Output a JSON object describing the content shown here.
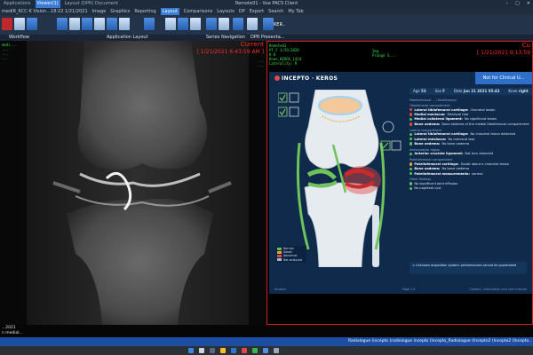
{
  "window": {
    "tabs": [
      "Applications",
      "Viewer(1)",
      "Layout (DPR) Document"
    ],
    "active_tab_index": 1,
    "title": "Remote01 - Vue PACS Client",
    "controls": [
      "–",
      "□",
      "✕"
    ]
  },
  "menu": {
    "items": [
      "mediR_6CC-K Vision...18:22 1/21/2021",
      "Image",
      "Graphics",
      "Reporting",
      "Layout",
      "Comparisons",
      "Layouts",
      "DP",
      "Export",
      "Search",
      "My Tab"
    ],
    "active_index": 4
  },
  "sections": {
    "workflow": "Workflow",
    "app_layout": "Application Layout",
    "series_nav": "Series Navigation",
    "dpr": "DPR Presenta...",
    "kero_btn": "KER.."
  },
  "left_viewport": {
    "current_label": "Current",
    "current_date": "[ 1/21/2021 6:43:59 AM ]",
    "overlay_left": [
      "medi...",
      "...",
      "...",
      "..."
    ],
    "overlay_right": [
      "...",
      "..."
    ]
  },
  "right_viewport": {
    "current_label": "Cu",
    "current_date": "[ 1/21/2021 9:13:59",
    "overlay": [
      "Remote01",
      "PT F 1/29/2020",
      "K-8",
      "Knee_KEROS_1424",
      "Laterality: R"
    ],
    "overlay_right": [
      "Img",
      "Prange S..."
    ]
  },
  "report": {
    "brand": "INCEPTO · KEROS",
    "not_clinical": "Not for Clinical U...",
    "patient": {
      "age_label": "Age",
      "age": "53",
      "sex_label": "Sex",
      "sex": "F",
      "date_label": "Date",
      "date": "Jan 21 2021 05:43",
      "knee_label": "Knee",
      "knee": "right"
    },
    "headline": "Patellofemoral ... / tibiofemoral",
    "groups": [
      {
        "title": "Tibiofemoral compartment",
        "items": [
          {
            "color": "#e24a4a",
            "label": "Lateral tibiofemoral cartilage:",
            "value": "Chondral lesion"
          },
          {
            "color": "#e24a4a",
            "label": "Medial meniscus:",
            "value": "Meniscal tear"
          },
          {
            "color": "#5cc25c",
            "label": "Medial collateral ligament:",
            "value": "No significant lesion"
          },
          {
            "color": "#e24a4a",
            "label": "Bone oedema:",
            "value": "Bone oedema of the medial tibiofemoral compartment"
          }
        ]
      },
      {
        "title": "Lateral compartment",
        "items": [
          {
            "color": "#5cc25c",
            "label": "Lateral tibiofemoral cartilage:",
            "value": "No chondral lesion detected"
          },
          {
            "color": "#5cc25c",
            "label": "Lateral meniscus:",
            "value": "No meniscal tear"
          },
          {
            "color": "#5cc25c",
            "label": "Bone oedema:",
            "value": "No bone oedema"
          }
        ]
      },
      {
        "title": "Intercondylar region",
        "items": [
          {
            "color": "#5cc25c",
            "label": "Anterior cruciate ligament:",
            "value": "Not torn detected"
          }
        ]
      },
      {
        "title": "Patellofemoral compartment",
        "items": [
          {
            "color": "#f0a030",
            "label": "Patellofemoral cartilage:",
            "value": "Doubt about a chondral lesion"
          },
          {
            "color": "#5cc25c",
            "label": "Bone oedema:",
            "value": "No bone oedema"
          },
          {
            "color": "#5cc25c",
            "label": "Patellofemoral measurements:",
            "value": "normal"
          }
        ]
      },
      {
        "title": "Other findings",
        "items": [
          {
            "color": "#5cc25c",
            "label": "",
            "value": "No significant joint effusion"
          },
          {
            "color": "#5cc25c",
            "label": "",
            "value": "No popliteal cyst"
          }
        ]
      }
    ],
    "legend": [
      {
        "color": "#5cc25c",
        "label": "Normal"
      },
      {
        "color": "#f0a030",
        "label": "Doubt"
      },
      {
        "color": "#e24a4a",
        "label": "Abnormal"
      },
      {
        "color": "#aab8c8",
        "label": "Not analysed"
      }
    ],
    "warning": "Unknown acquisition system: performances cannot be guaranteed",
    "footer_left": "Incepto",
    "footer_mid": "Page 1/1",
    "footer_right": "Contact, information and user manual"
  },
  "bottom": {
    "left_date": "...2021",
    "left_line2": "n medial..."
  },
  "statusbar": {
    "text": "Radiologue (incepto (radiologue incepto (incepto_Radiologue (Incepto2 (Incepto2 (Incepto..."
  },
  "colors": {
    "overlay_green": "#2fe04a",
    "overlay_red": "#ff2b2b",
    "report_bg": "#0f2a4a",
    "accent_blue": "#2d6fc9"
  }
}
